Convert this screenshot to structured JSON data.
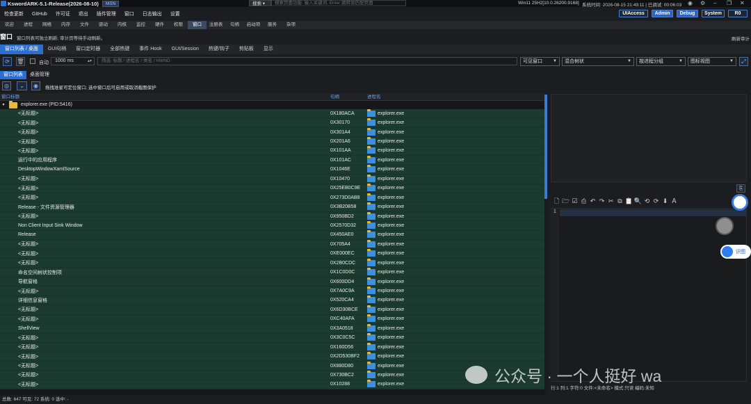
{
  "titlebar": {
    "title": "KswordARK-5.1-Release(2026-08-10)",
    "badge": "MSN",
    "search_scope": "搜索 ▾",
    "search_placeholder": "搜索页面功能: 输入关键词, Enter 跳转到匹配页面",
    "os": "Win11 25H2[10.0.26200.9168]",
    "system_time": "系统时间: 2026-08-15 21:49:11 | 已调试: 00:06:03"
  },
  "menu": [
    "检查更新",
    "GitHub",
    "许可证",
    "退出",
    "插件管理",
    "窗口",
    "日志输出",
    "设置"
  ],
  "badges": {
    "uiaccess": "UIAccess",
    "admin": "Admin",
    "debug": "Debug",
    "system": "System",
    "r0": "R0"
  },
  "main_tabs": [
    "欢迎",
    "进程",
    "网络",
    "内存",
    "文件",
    "驱动",
    "内核",
    "监控",
    "硬件",
    "权限",
    "窗口",
    "注册表",
    "句柄",
    "启动项",
    "服务",
    "杂项"
  ],
  "main_tab_active": "窗口",
  "window_title": "窗口",
  "window_hint": "窗口列表可独立刷新; 审计页等待手动刷新。",
  "refresh_audit": "刷新审计",
  "sub_tabs": [
    "窗口列表 / 桌面",
    "GUI句柄",
    "窗口定时器",
    "全部热键",
    "事件 Hook",
    "GUI/Session",
    "热键/钩子",
    "剪贴板",
    "显示"
  ],
  "controls": {
    "auto_label": "自动",
    "interval": "1000 ms",
    "filter_placeholder": "筛选: 标题 / 进程名 / 类名 / HWND",
    "visibility": "可见窗口",
    "tree_mode": "混合树状",
    "grouping": "按进程分组",
    "view": "图标视图"
  },
  "view_tabs": [
    "窗口列表",
    "桌面管理"
  ],
  "lock_hint": "拖拽准星可定位窗口; 选中窗口后可启用或取消截图保护",
  "columns": [
    "窗口标题",
    "句柄",
    "进程名"
  ],
  "root_node": "explorer.exe (PID:5416)",
  "rows": [
    [
      "<无标题>",
      "0X180ACA",
      "explorer.exe"
    ],
    [
      "<无标题>",
      "0X30170",
      "explorer.exe"
    ],
    [
      "<无标题>",
      "0X301A4",
      "explorer.exe"
    ],
    [
      "<无标题>",
      "0X201A6",
      "explorer.exe"
    ],
    [
      "<无标题>",
      "0X101AA",
      "explorer.exe"
    ],
    [
      "运行中的应用程序",
      "0X101AC",
      "explorer.exe"
    ],
    [
      "DesktopWindowXamlSource",
      "0X1046E",
      "explorer.exe"
    ],
    [
      "<无标题>",
      "0X10470",
      "explorer.exe"
    ],
    [
      "<无标题>",
      "0X25EB0C9E",
      "explorer.exe"
    ],
    [
      "<无标题>",
      "0X273D0AB8",
      "explorer.exe"
    ],
    [
      "Release - 文件资源管理器",
      "0X3B20B58",
      "explorer.exe"
    ],
    [
      "<无标题>",
      "0X950BD2",
      "explorer.exe"
    ],
    [
      "Non Client Input Sink Window",
      "0X2570D32",
      "explorer.exe"
    ],
    [
      "Release",
      "0X450AE0",
      "explorer.exe"
    ],
    [
      "<无标题>",
      "0X705A4",
      "explorer.exe"
    ],
    [
      "<无标题>",
      "0XE000EC",
      "explorer.exe"
    ],
    [
      "<无标题>",
      "0X2B0CDC",
      "explorer.exe"
    ],
    [
      "命名空间树状控制项",
      "0X1C0D0C",
      "explorer.exe"
    ],
    [
      "导航窗格",
      "0X600DD4",
      "explorer.exe"
    ],
    [
      "<无标题>",
      "0X7A0C9A",
      "explorer.exe"
    ],
    [
      "详细信息窗格",
      "0X520CA4",
      "explorer.exe"
    ],
    [
      "<无标题>",
      "0X6D30BCE",
      "explorer.exe"
    ],
    [
      "<无标题>",
      "0XC40AFA",
      "explorer.exe"
    ],
    [
      "ShellView",
      "0X3A0518",
      "explorer.exe"
    ],
    [
      "<无标题>",
      "0X3C0C5C",
      "explorer.exe"
    ],
    [
      "<无标题>",
      "0X160D56",
      "explorer.exe"
    ],
    [
      "<无标题>",
      "0X2D530BF2",
      "explorer.exe"
    ],
    [
      "<无标题>",
      "0X880D80",
      "explorer.exe"
    ],
    [
      "<无标题>",
      "0X730BC2",
      "explorer.exe"
    ],
    [
      "<无标题>",
      "0X10288",
      "explorer.exe"
    ]
  ],
  "editor": {
    "line_number": "1",
    "status": "行:1 列:1 字符:0 文件:<未命名> 模式:只读 编码:未知"
  },
  "footer": "总数: 647 可见: 72 系统: 0 选中: -",
  "watermark": "公众号 · 一个人挺好 wa",
  "float_identify": "识图"
}
